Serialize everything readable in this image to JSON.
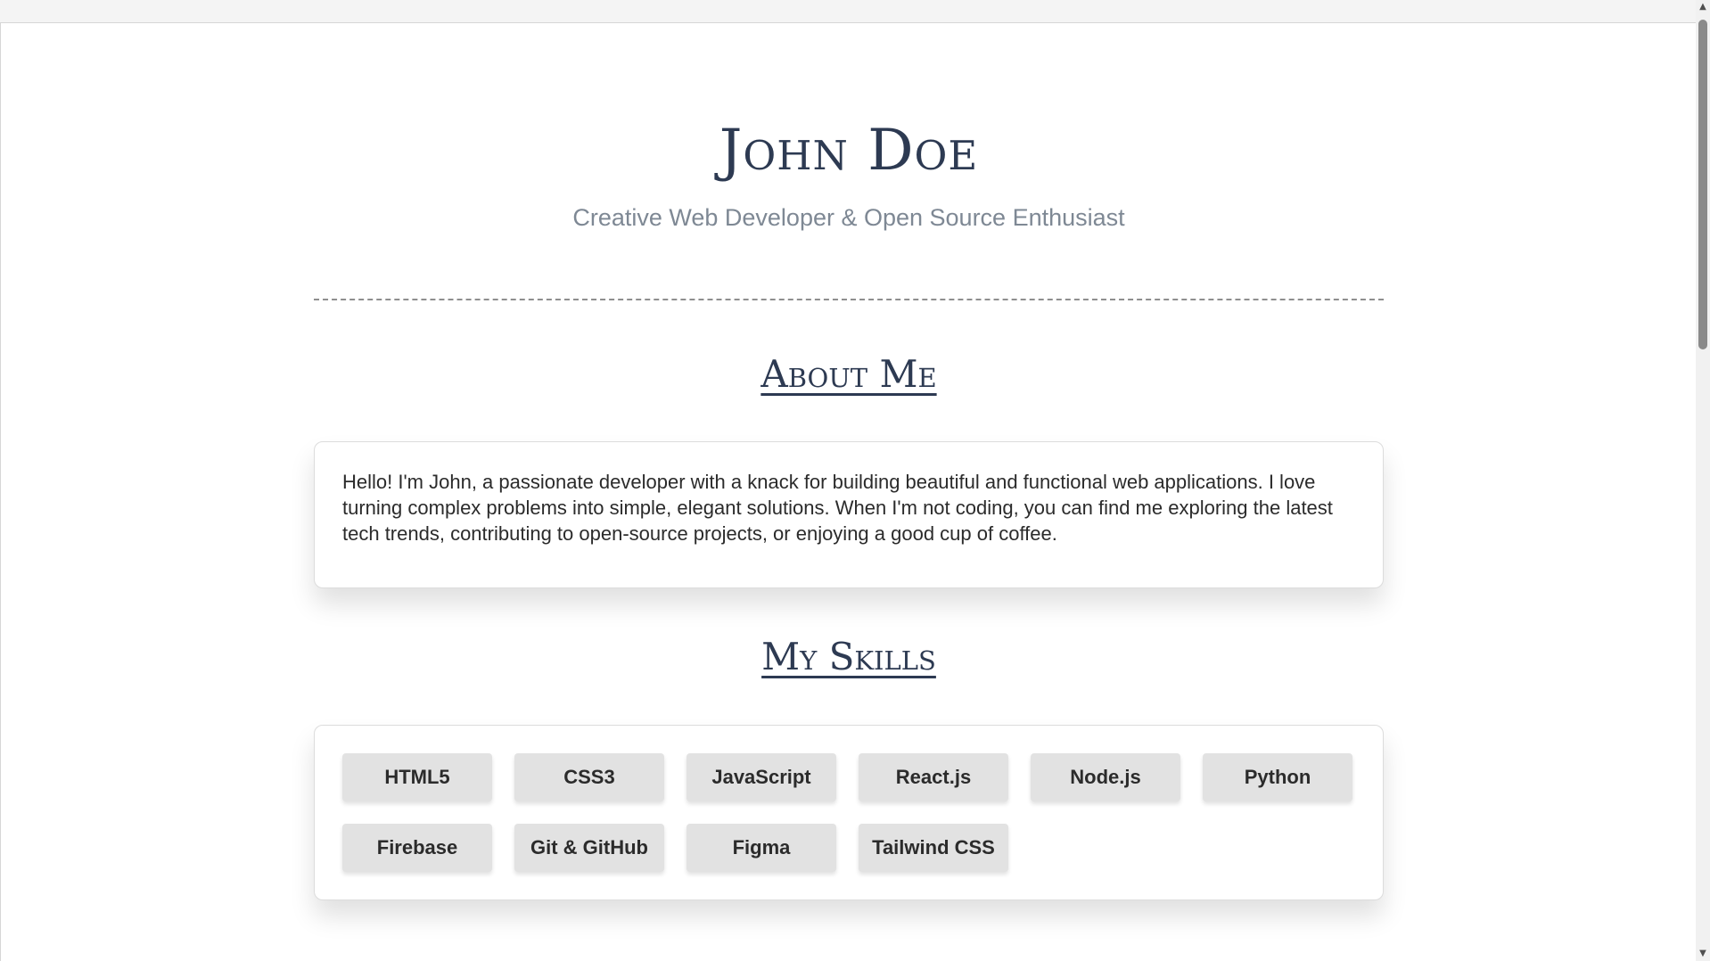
{
  "profile": {
    "name": "John Doe",
    "tagline": "Creative Web Developer & Open Source Enthusiast"
  },
  "about": {
    "title": "About Me",
    "text": "Hello! I'm John, a passionate developer with a knack for building beautiful and functional web applications. I love turning complex problems into simple, elegant solutions. When I'm not coding, you can find me exploring the latest tech trends, contributing to open-source projects, or enjoying a good cup of coffee."
  },
  "skills": {
    "title": "My Skills",
    "items": [
      {
        "label": "HTML5"
      },
      {
        "label": "CSS3"
      },
      {
        "label": "JavaScript"
      },
      {
        "label": "React.js"
      },
      {
        "label": "Node.js"
      },
      {
        "label": "Python"
      },
      {
        "label": "Firebase"
      },
      {
        "label": "Git & GitHub"
      },
      {
        "label": "Figma"
      },
      {
        "label": "Tailwind CSS"
      }
    ]
  },
  "icons": {
    "scroll_up": "scroll-up-arrow-icon",
    "scroll_down": "scroll-down-arrow-icon"
  },
  "colors": {
    "heading": "#2d3a52",
    "tagline": "#7e8894",
    "skill_bg": "#e2e2e2",
    "page_bg": "#ffffff"
  }
}
